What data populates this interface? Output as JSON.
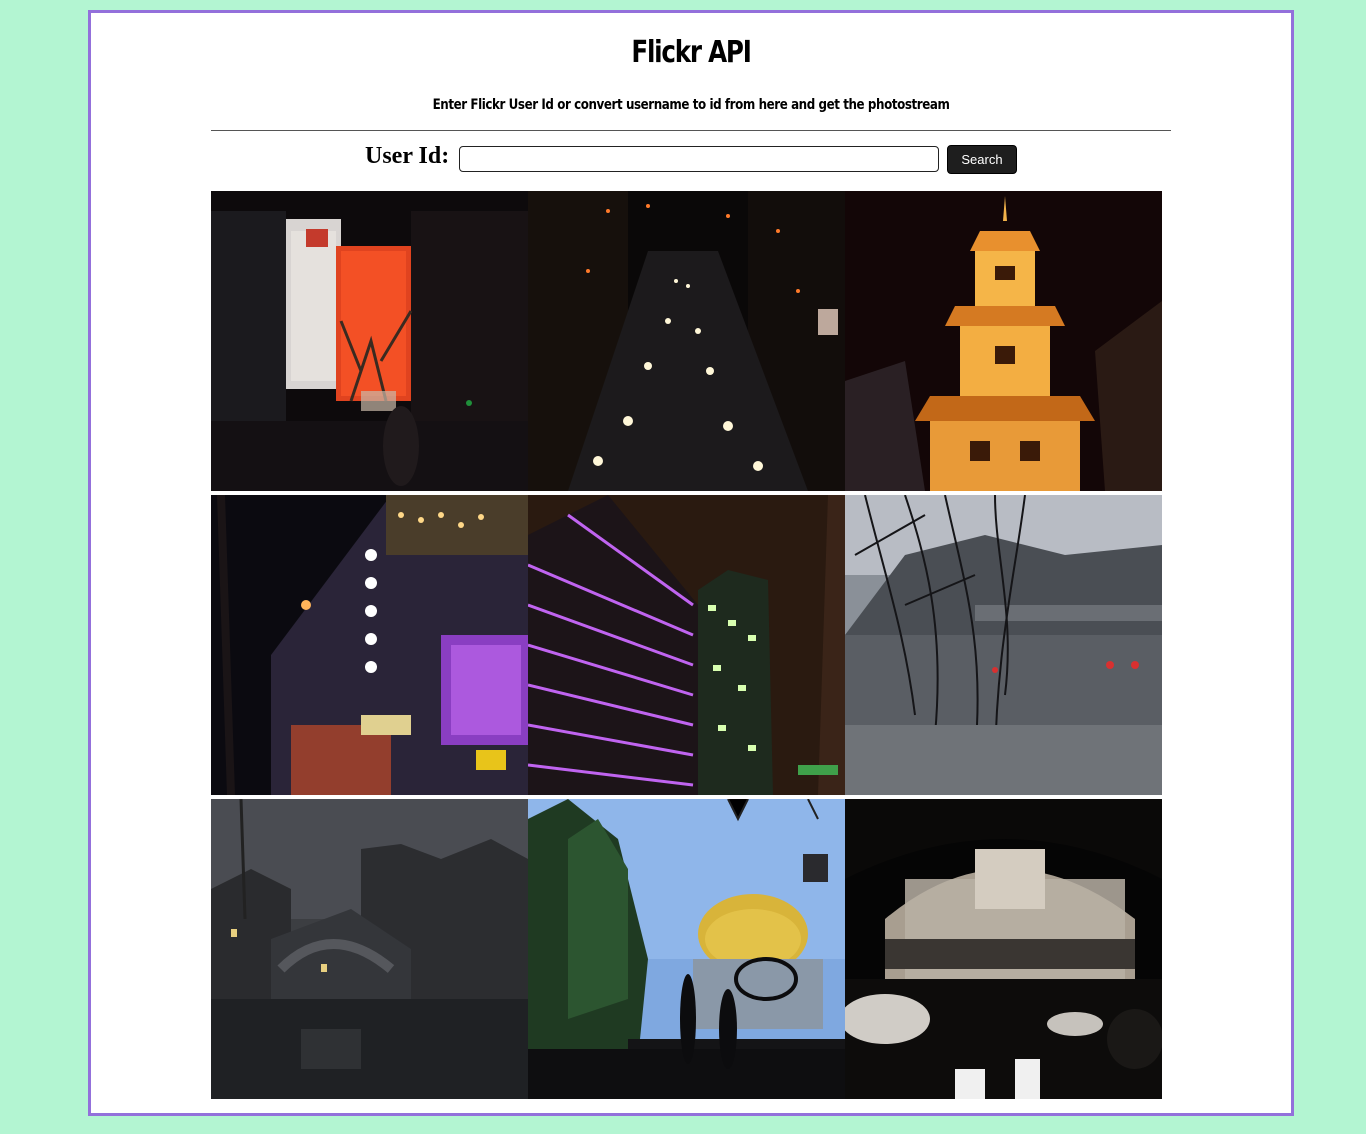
{
  "header": {
    "title": "Flickr API",
    "subtitle": "Enter Flickr User Id or convert username to id from here and get the photostream"
  },
  "search": {
    "label": "User Id:",
    "value": "",
    "placeholder": "",
    "button_label": "Search"
  },
  "colors": {
    "page_background": "#b3f5d2",
    "frame_border": "#9370db",
    "button_background": "#1e1e1e"
  },
  "photos": [
    {
      "scene": "night-street-luxury-stores"
    },
    {
      "scene": "night-traffic-avenue"
    },
    {
      "scene": "illuminated-pagoda-tower"
    },
    {
      "scene": "neon-department-store"
    },
    {
      "scene": "purple-lit-office-towers"
    },
    {
      "scene": "rainy-water-town-branches"
    },
    {
      "scene": "dusk-canal-bridge"
    },
    {
      "scene": "golden-dome-silhouettes"
    },
    {
      "scene": "dark-alley-arch"
    }
  ]
}
